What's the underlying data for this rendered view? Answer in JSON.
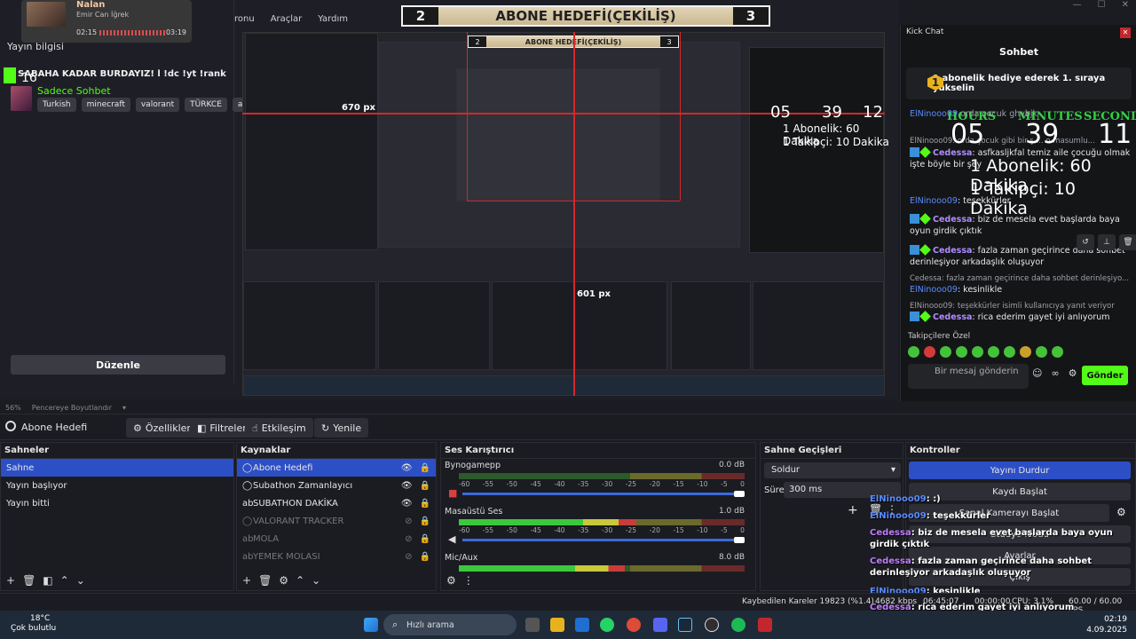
{
  "menu": {
    "items": [
      "ronu",
      "Araçlar",
      "Yardım"
    ]
  },
  "goal": {
    "left_num": "2",
    "title": "ABONE HEDEFİ(ÇEKİLİŞ)",
    "right_num": "3"
  },
  "now_playing": {
    "title": "Nalan",
    "artist": "Emir Can İğrek",
    "elapsed": "02:15",
    "total": "03:19"
  },
  "stream_info": {
    "label": "Yayın bilgisi",
    "title": "SABAHA KADAR BURDAYIZ! l !dc !yt !rank",
    "viewer_count": "16",
    "category": "Sadece Sohbet",
    "tags": [
      "Turkish",
      "minecraft",
      "valorant",
      "TÜRKCE",
      "ailey"
    ],
    "edit_button": "Düzenle"
  },
  "measurements": {
    "width_label": "670 px",
    "height_label": "601 px"
  },
  "timer": {
    "hours_label": "HOURS",
    "minutes_label": "MINUTES",
    "seconds_label": "SECONDS",
    "hours": "05",
    "minutes": "39",
    "seconds": "11",
    "line1": "1 Abonelik: 60 Dakika",
    "line2": "1 Takipçi: 10 Dakika"
  },
  "nested_timer": {
    "hours": "05",
    "minutes": "39",
    "seconds": "12",
    "line1": "1 Abonelik: 60 Dakika",
    "line2": "1 Takipçi: 10 Dakika"
  },
  "kick_chat": {
    "window_title": "Kick Chat",
    "header": "Sohbet",
    "pinned": {
      "badge": "1",
      "text": "1 abonelik hediye ederek 1. sıraya yükselin"
    },
    "messages": [
      {
        "user": "ElNinooo09",
        "text": "orda çocuk ghvbjk",
        "kind": "fade"
      },
      {
        "user": "",
        "text": "ElNinooo09: orda çocuk gibi bir ş ... o masumlu...",
        "kind": "sys"
      },
      {
        "user": "Cedessa",
        "text": "asfkasljkfal temiz aile çocuğu olmak işte böyle bir şey",
        "kind": "msg"
      },
      {
        "user": "ElNinooo09",
        "text": "teşekkürler",
        "kind": "msg2"
      },
      {
        "user": "Cedessa",
        "text": "biz de mesela evet başlarda baya oyun girdik çıktık",
        "kind": "msg"
      },
      {
        "user": "Cedessa",
        "text": "fazla zaman geçirince daha sohbet derinleşiyor arkadaşlık oluşuyor",
        "kind": "msg"
      },
      {
        "user": "",
        "text": "Cedessa: fazla zaman geçirince daha sohbet derinleşiyo...",
        "kind": "sys"
      },
      {
        "user": "ElNinooo09",
        "text": "kesinlikle",
        "kind": "msg2"
      },
      {
        "user": "",
        "text": "ElNinooo09: teşekkürler isimli kullanıcıya yanıt veriyor",
        "kind": "sys"
      },
      {
        "user": "Cedessa",
        "text": "rica ederim gayet iyi anlıyorum",
        "kind": "msg"
      }
    ],
    "emote_label": "Takipçilere Özel",
    "input_placeholder": "Bir mesaj gönderin",
    "send_label": "Gönder"
  },
  "zoom": {
    "percent": "56%",
    "mode": "Pencereye Boyutlandır"
  },
  "toolbar": {
    "source": "Abone Hedefi",
    "properties": "Özellikler",
    "filters": "Filtreler",
    "interact": "Etkileşim",
    "refresh": "Yenile"
  },
  "scenes": {
    "title": "Sahneler",
    "items": [
      "Sahne",
      "Yayın başlıyor",
      "Yayın bitti"
    ],
    "selected": 0
  },
  "sources": {
    "title": "Kaynaklar",
    "items": [
      {
        "name": "Abone Hedefi",
        "visible": true
      },
      {
        "name": "Subathon Zamanlayıcı",
        "visible": true
      },
      {
        "name": "SUBATHON DAKİKA",
        "visible": true
      },
      {
        "name": "VALORANT TRACKER",
        "visible": false
      },
      {
        "name": "MOLA",
        "visible": false
      },
      {
        "name": "YEMEK MOLASI",
        "visible": false
      }
    ]
  },
  "mixer": {
    "title": "Ses Karıştırıcı",
    "ticks": [
      "-60",
      "-55",
      "-50",
      "-45",
      "-40",
      "-35",
      "-30",
      "-25",
      "-20",
      "-15",
      "-10",
      "-5",
      "0"
    ],
    "channels": [
      {
        "name": "Bynogamepp",
        "db": "0.0 dB",
        "level": 0
      },
      {
        "name": "Masaüstü Ses",
        "db": "1.0 dB",
        "level": 0.62
      },
      {
        "name": "Mic/Aux",
        "db": "8.0 dB",
        "level": 0.58
      }
    ]
  },
  "transitions": {
    "title": "Sahne Geçişleri",
    "selected": "Soldur",
    "duration_label": "Süre",
    "duration": "300 ms"
  },
  "controls": {
    "title": "Kontroller",
    "buttons": [
      "Yayını Durdur",
      "Kaydı Başlat",
      "Sanal Kamerayı Başlat",
      "Stüdyo Modu",
      "Ayarlar",
      "Çıkış"
    ]
  },
  "status": {
    "dropped": "Kaybedilen Kareler 19823 (%1.4)",
    "bitrate": "4682 kbps",
    "time": "06:45:07",
    "rec": "00:00:00",
    "cpu": "CPU: 3.1%",
    "fps": "60.00 / 60.00 FPS"
  },
  "overlay_chat": [
    {
      "user": "ElNinooo09",
      "text": ":)"
    },
    {
      "user": "ElNinooo09",
      "text": "teşekkürler"
    },
    {
      "user": "Cedessa",
      "text": "biz de mesela evet başlarda baya oyun girdik çıktık"
    },
    {
      "user": "Cedessa",
      "text": "fazla zaman geçirince daha sohbet derinleşiyor arkadaşlık oluşuyor"
    },
    {
      "user": "ElNinooo09",
      "text": "kesinlikle"
    },
    {
      "user": "Cedessa",
      "text": "rica ederim gayet iyi anlıyorum"
    }
  ],
  "taskbar": {
    "temp": "18°C",
    "weather": "Çok bulutlu",
    "search": "Hızlı arama",
    "time": "02:19",
    "date": "4.09.2025"
  },
  "colors": {
    "accent": "#2d4fc6",
    "kick_green": "#53fc18",
    "red_guide": "#d8262a",
    "send_green": "#53fc18"
  }
}
